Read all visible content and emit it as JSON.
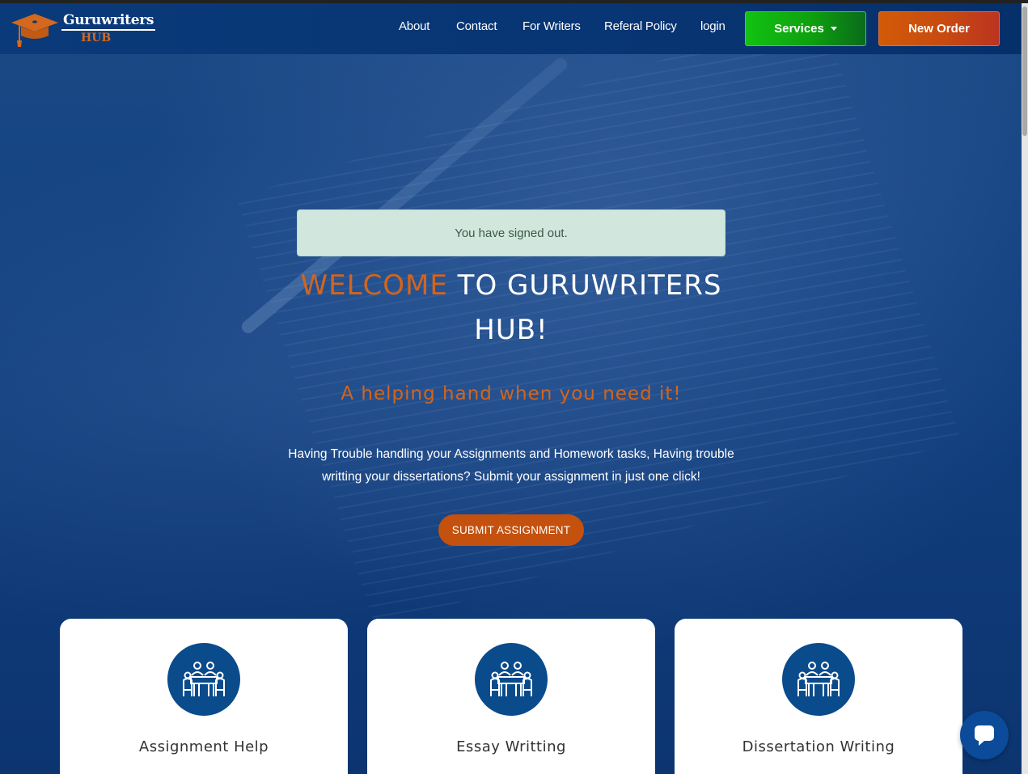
{
  "brand": {
    "name": "Guruwriters",
    "sub": "HUB"
  },
  "nav": {
    "links": [
      "About",
      "Contact",
      "For Writers",
      "Referal Policy",
      "login"
    ],
    "services_label": "Services",
    "new_order_label": "New Order"
  },
  "alert": {
    "message": "You have signed out."
  },
  "hero": {
    "headline_accent": "WELCOME",
    "headline_rest": " TO GURUWRITERS HUB!",
    "tagline": "A helping hand when you need it!",
    "description": "Having Trouble handling your Assignments and Homework tasks, Having trouble writting your dissertations? Submit your assignment in just one click!",
    "cta_label": "SUBMIT ASSIGNMENT"
  },
  "cards": [
    {
      "title": "Assignment Help",
      "icon": "meeting-table-icon"
    },
    {
      "title": "Essay Writting",
      "icon": "meeting-table-icon"
    },
    {
      "title": "Dissertation Writing",
      "icon": "meeting-table-icon"
    }
  ],
  "colors": {
    "navbar": "#0a3a7a",
    "accent_orange": "#d2651d",
    "services_green": "#12c212",
    "new_order_orange": "#c74a10",
    "alert_bg": "#d1e7dd",
    "icon_circle": "#0a4b8c"
  },
  "chat": {
    "icon": "chat-icon"
  }
}
